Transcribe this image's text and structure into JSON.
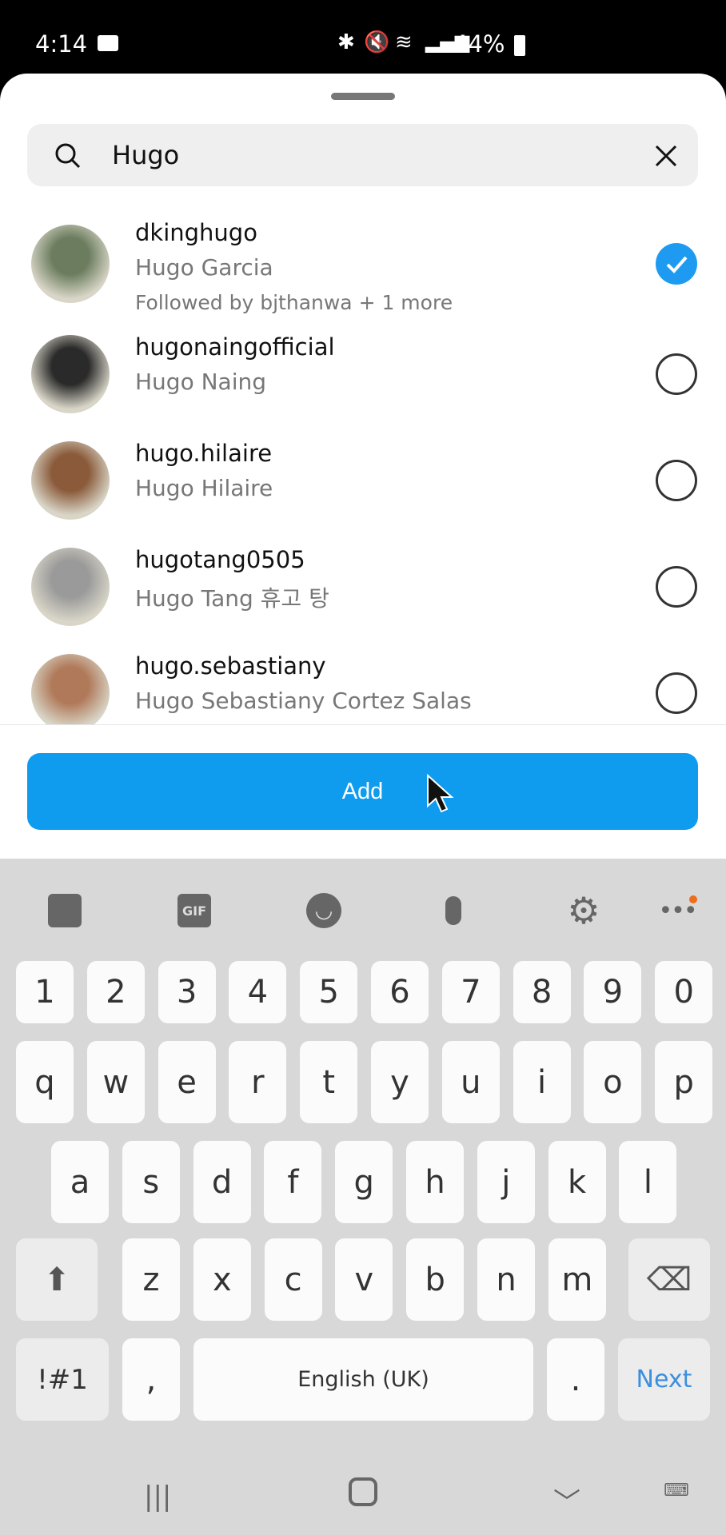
{
  "status": {
    "time": "4:14",
    "battery": "44%",
    "icons": [
      "video-record-icon",
      "bluetooth-icon",
      "mute-icon",
      "wifi-icon",
      "signal-icon",
      "battery-icon"
    ]
  },
  "search": {
    "value": "Hugo",
    "icon": "search-icon",
    "clear_icon": "close-icon"
  },
  "results": [
    {
      "username": "dkinghugo",
      "name": "Hugo Garcia",
      "followed": "Followed by bjthanwa + 1 more",
      "selected": true,
      "avatar_color": "#6b7d5e"
    },
    {
      "username": "hugonaingofficial",
      "name": "Hugo Naing",
      "selected": false,
      "avatar_color": "#2a2a2a"
    },
    {
      "username": "hugo.hilaire",
      "name": "Hugo Hilaire",
      "selected": false,
      "avatar_color": "#8a5a3a"
    },
    {
      "username": "hugotang0505",
      "name": "Hugo Tang 휴고 탕",
      "selected": false,
      "avatar_color": "#9a9a9a"
    },
    {
      "username": "hugo.sebastiany",
      "name": "Hugo Sebastiany Cortez Salas",
      "selected": false,
      "avatar_color": "#b07a5a"
    }
  ],
  "add_button": {
    "label": "Add"
  },
  "keyboard": {
    "toolbar": [
      "sticker-icon",
      "gif-icon",
      "emoji-icon",
      "microphone-icon",
      "settings-icon",
      "more-icon"
    ],
    "gif_label": "GIF",
    "rows": [
      [
        "1",
        "2",
        "3",
        "4",
        "5",
        "6",
        "7",
        "8",
        "9",
        "0"
      ],
      [
        "q",
        "w",
        "e",
        "r",
        "t",
        "y",
        "u",
        "i",
        "o",
        "p"
      ],
      [
        "a",
        "s",
        "d",
        "f",
        "g",
        "h",
        "j",
        "k",
        "l"
      ],
      [
        "z",
        "x",
        "c",
        "v",
        "b",
        "n",
        "m"
      ]
    ],
    "symbols": "!#1",
    "comma": ",",
    "space": "English (UK)",
    "period": ".",
    "next": "Next",
    "accent": "#3a8fe0"
  },
  "nav": [
    "recent-apps-icon",
    "home-icon",
    "hide-keyboard-icon",
    "keyboard-switch-icon"
  ]
}
